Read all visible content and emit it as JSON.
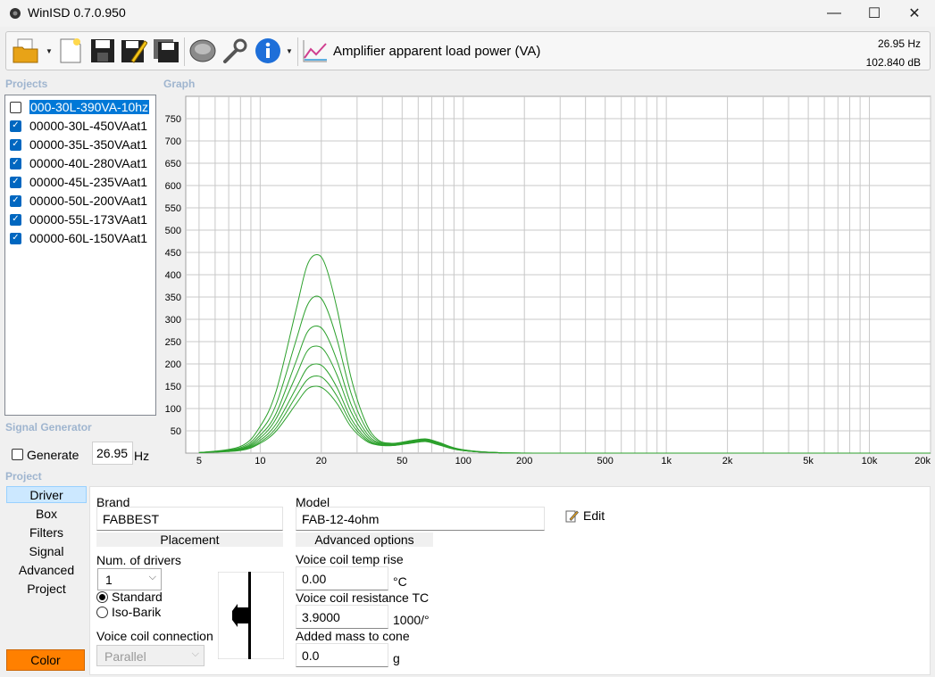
{
  "window": {
    "title": "WinISD 0.7.0.950",
    "minimize": "—",
    "maximize": "☐",
    "close": "✕"
  },
  "toolbar": {
    "graph_selector": "Amplifier apparent load power (VA)",
    "frequency": "26.95 Hz",
    "level": "102.840 dB",
    "icons": [
      "open-folder-icon",
      "new-document-icon",
      "save-icon",
      "save-as-icon",
      "save-all-icon",
      "driver-icon",
      "wrench-icon",
      "info-icon",
      "graph-type-icon"
    ]
  },
  "projects": {
    "label": "Projects",
    "items": [
      {
        "name": "000-30L-390VA-10hz",
        "checked": false,
        "selected": true
      },
      {
        "name": "00000-30L-450VAat1",
        "checked": true,
        "selected": false
      },
      {
        "name": "00000-35L-350VAat1",
        "checked": true,
        "selected": false
      },
      {
        "name": "00000-40L-280VAat1",
        "checked": true,
        "selected": false
      },
      {
        "name": "00000-45L-235VAat1",
        "checked": true,
        "selected": false
      },
      {
        "name": "00000-50L-200VAat1",
        "checked": true,
        "selected": false
      },
      {
        "name": "00000-55L-173VAat1",
        "checked": true,
        "selected": false
      },
      {
        "name": "00000-60L-150VAat1",
        "checked": true,
        "selected": false
      }
    ]
  },
  "signal_generator": {
    "label": "Signal Generator",
    "generate_label": "Generate",
    "generate_checked": false,
    "frequency_value": "26.95",
    "unit": "Hz"
  },
  "graph": {
    "label": "Graph"
  },
  "chart_data": {
    "type": "line",
    "x_scale": "log",
    "xlim": [
      4.3,
      20000
    ],
    "ylim": [
      0,
      800
    ],
    "x_ticks": [
      5,
      10,
      20,
      50,
      100,
      200,
      500,
      1000,
      2000,
      5000,
      10000,
      20000
    ],
    "x_tick_labels": [
      "5",
      "10",
      "20",
      "50",
      "100",
      "200",
      "500",
      "1k",
      "2k",
      "5k",
      "10k",
      "20k"
    ],
    "y_ticks": [
      50,
      100,
      150,
      200,
      250,
      300,
      350,
      400,
      450,
      500,
      550,
      600,
      650,
      700,
      750
    ],
    "grid": true,
    "line_color": "#2ca02c",
    "series": [
      {
        "x": [
          5,
          8,
          10,
          12,
          15,
          17,
          19,
          21,
          24,
          28,
          33,
          38,
          45,
          55,
          65,
          75,
          90,
          110,
          150,
          250,
          20000
        ],
        "y": [
          1,
          15,
          60,
          140,
          320,
          420,
          445,
          420,
          320,
          170,
          70,
          30,
          22,
          28,
          32,
          25,
          12,
          5,
          1,
          0,
          0
        ]
      },
      {
        "x": [
          5,
          8,
          10,
          12,
          15,
          17,
          19,
          21,
          24,
          28,
          33,
          38,
          45,
          55,
          65,
          75,
          90,
          110,
          150,
          250,
          20000
        ],
        "y": [
          1,
          12,
          48,
          110,
          252,
          330,
          352,
          330,
          252,
          135,
          58,
          27,
          21,
          27,
          31,
          24,
          11,
          5,
          1,
          0,
          0
        ]
      },
      {
        "x": [
          5,
          8,
          10,
          12,
          15,
          17,
          19,
          21,
          24,
          28,
          33,
          38,
          45,
          55,
          65,
          75,
          90,
          110,
          150,
          250,
          20000
        ],
        "y": [
          1,
          10,
          40,
          90,
          205,
          270,
          285,
          268,
          205,
          110,
          48,
          24,
          20,
          26,
          30,
          23,
          11,
          4,
          1,
          0,
          0
        ]
      },
      {
        "x": [
          5,
          8,
          10,
          12,
          15,
          17,
          19,
          21,
          24,
          28,
          33,
          38,
          45,
          55,
          65,
          75,
          90,
          110,
          150,
          250,
          20000
        ],
        "y": [
          1,
          9,
          34,
          78,
          173,
          228,
          240,
          226,
          173,
          93,
          41,
          22,
          19,
          25,
          29,
          22,
          10,
          4,
          1,
          0,
          0
        ]
      },
      {
        "x": [
          5,
          8,
          10,
          12,
          15,
          17,
          19,
          21,
          24,
          28,
          33,
          38,
          45,
          55,
          65,
          75,
          90,
          110,
          150,
          250,
          20000
        ],
        "y": [
          1,
          8,
          29,
          66,
          145,
          190,
          200,
          188,
          145,
          78,
          35,
          20,
          18,
          24,
          28,
          21,
          10,
          4,
          1,
          0,
          0
        ]
      },
      {
        "x": [
          5,
          8,
          10,
          12,
          15,
          17,
          19,
          21,
          24,
          28,
          33,
          38,
          45,
          55,
          65,
          75,
          90,
          110,
          150,
          250,
          20000
        ],
        "y": [
          1,
          7,
          25,
          57,
          127,
          164,
          173,
          163,
          126,
          68,
          31,
          19,
          17,
          23,
          27,
          20,
          9,
          4,
          1,
          0,
          0
        ]
      },
      {
        "x": [
          5,
          8,
          10,
          12,
          15,
          17,
          19,
          21,
          24,
          28,
          33,
          38,
          45,
          55,
          65,
          75,
          90,
          110,
          150,
          250,
          20000
        ],
        "y": [
          1,
          6,
          22,
          50,
          110,
          143,
          150,
          141,
          110,
          59,
          28,
          18,
          17,
          22,
          26,
          19,
          9,
          4,
          1,
          0,
          0
        ]
      }
    ]
  },
  "project_panel": {
    "label": "Project",
    "nav": [
      "Driver",
      "Box",
      "Filters",
      "Signal",
      "Advanced",
      "Project"
    ],
    "selected_nav": "Driver",
    "color_button": "Color",
    "color_value": "#ff8000",
    "brand_label": "Brand",
    "brand_value": "FABBEST",
    "model_label": "Model",
    "model_value": "FAB-12-4ohm",
    "edit_label": "Edit",
    "placement_header": "Placement",
    "advanced_header": "Advanced options",
    "num_drivers_label": "Num. of drivers",
    "num_drivers_value": "1",
    "standard_label": "Standard",
    "isobarik_label": "Iso-Barik",
    "standard_selected": true,
    "vc_connection_label": "Voice coil connection",
    "vc_connection_value": "Parallel",
    "vc_temp_label": "Voice coil temp rise",
    "vc_temp_value": "0.00",
    "vc_temp_unit": "°C",
    "vc_res_label": "Voice coil resistance TC",
    "vc_res_value": "3.9000",
    "vc_res_unit": "1000/°",
    "added_mass_label": "Added mass to cone",
    "added_mass_value": "0.0",
    "added_mass_unit": "g"
  }
}
